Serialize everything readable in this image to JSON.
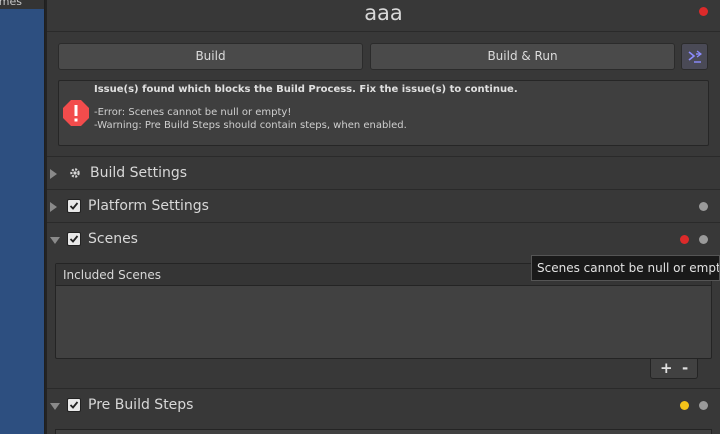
{
  "left_panel": {
    "fragment_text": "ames"
  },
  "window": {
    "title": "aaa",
    "status_color": "#dc2a2a"
  },
  "toolbar": {
    "build_label": "Build",
    "build_and_run_label": "Build & Run",
    "extra_icon": "build-menu-icon"
  },
  "issues": {
    "title": "Issue(s) found which blocks the Build Process. Fix the issue(s) to continue.",
    "lines": [
      "-Error: Scenes cannot be null or empty!",
      "-Warning: Pre Build Steps should contain steps, when enabled."
    ],
    "icon": "error-stop-icon",
    "icon_color": "#f24c4c"
  },
  "sections": {
    "build_settings": {
      "label": "Build Settings",
      "expanded": false,
      "icon": "gear-icon"
    },
    "platform_settings": {
      "label": "Platform Settings",
      "expanded": false,
      "checked": true
    },
    "scenes": {
      "label": "Scenes",
      "expanded": true,
      "checked": true,
      "status": "error",
      "list_header": "Included Scenes",
      "add_label": "+",
      "remove_label": "-"
    },
    "pre_build_steps": {
      "label": "Pre Build Steps",
      "expanded": true,
      "checked": true,
      "status": "warning"
    }
  },
  "tooltip": {
    "text": "Scenes cannot be null or empty!"
  },
  "colors": {
    "error": "#dc2a2a",
    "warning": "#f4c319",
    "background": "#383838"
  }
}
